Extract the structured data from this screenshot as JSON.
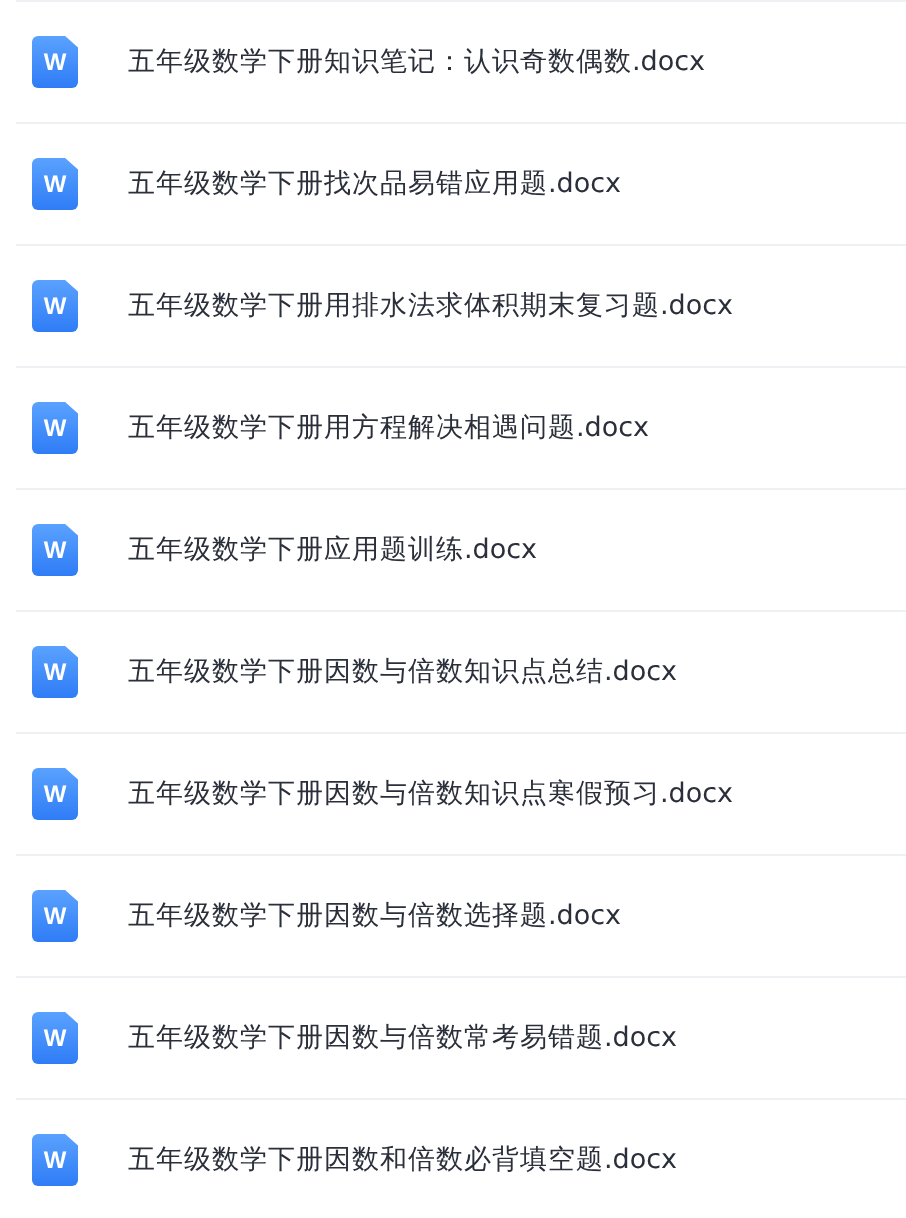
{
  "files": [
    {
      "icon_letter": "W",
      "name": "五年级数学下册知识笔记：认识奇数偶数.docx"
    },
    {
      "icon_letter": "W",
      "name": "五年级数学下册找次品易错应用题.docx"
    },
    {
      "icon_letter": "W",
      "name": "五年级数学下册用排水法求体积期末复习题.docx"
    },
    {
      "icon_letter": "W",
      "name": "五年级数学下册用方程解决相遇问题.docx"
    },
    {
      "icon_letter": "W",
      "name": "五年级数学下册应用题训练.docx"
    },
    {
      "icon_letter": "W",
      "name": "五年级数学下册因数与倍数知识点总结.docx"
    },
    {
      "icon_letter": "W",
      "name": "五年级数学下册因数与倍数知识点寒假预习.docx"
    },
    {
      "icon_letter": "W",
      "name": "五年级数学下册因数与倍数选择题.docx"
    },
    {
      "icon_letter": "W",
      "name": "五年级数学下册因数与倍数常考易错题.docx"
    },
    {
      "icon_letter": "W",
      "name": "五年级数学下册因数和倍数必背填空题.docx"
    }
  ]
}
